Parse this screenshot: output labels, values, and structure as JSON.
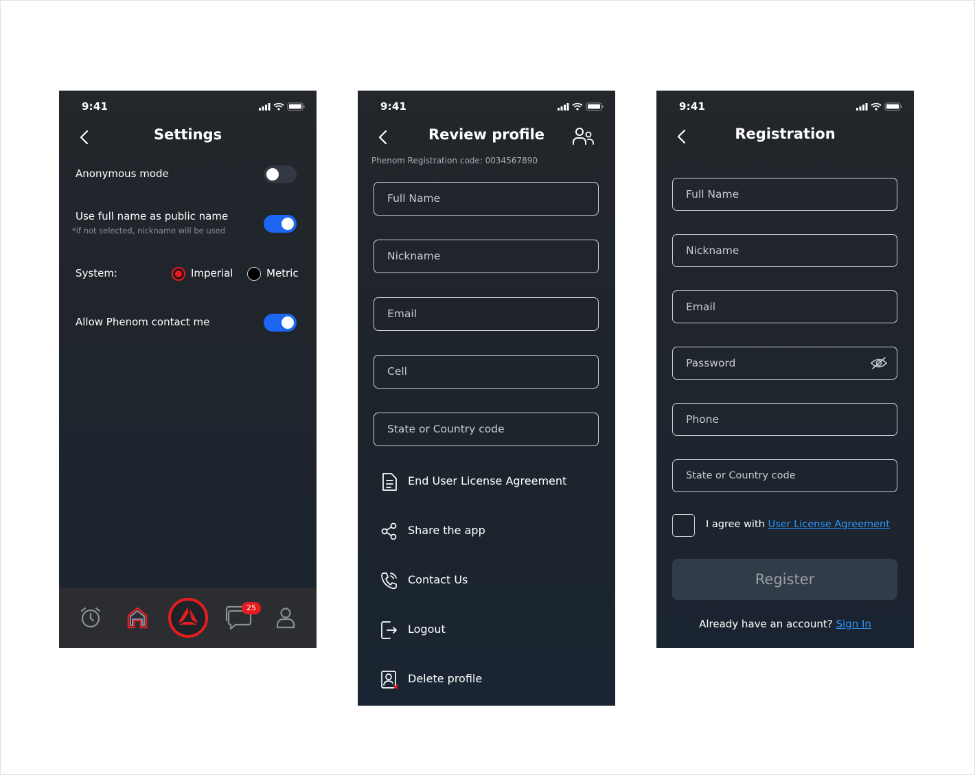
{
  "settings": {
    "status_time": "9:41",
    "title": "Settings",
    "anonymous_mode": {
      "label": "Anonymous mode",
      "enabled": false
    },
    "full_name_public": {
      "label": "Use full name as public name",
      "hint": "*if not selected, nickname will be used",
      "enabled": true
    },
    "system": {
      "label": "System:",
      "options": [
        "Imperial",
        "Metric"
      ],
      "selected": "Imperial"
    },
    "allow_contact": {
      "label": "Allow Phenom contact me",
      "enabled": true
    },
    "tabbar": {
      "items": [
        "alarm-icon",
        "home-icon",
        "phenom-logo-icon",
        "messages-icon",
        "profile-icon"
      ],
      "messages_badge": "25"
    }
  },
  "review_profile": {
    "status_time": "9:41",
    "title": "Review profile",
    "registration_code": "Phenom Registration code: 0034567890",
    "fields": [
      "Full Name",
      "Nickname",
      "Email",
      "Cell",
      "State or Country code"
    ],
    "menu": [
      {
        "label": "End User License Agreement",
        "icon": "document-icon"
      },
      {
        "label": "Share the app",
        "icon": "share-icon"
      },
      {
        "label": "Contact Us",
        "icon": "phone-call-icon"
      },
      {
        "label": "Logout",
        "icon": "logout-icon"
      },
      {
        "label": "Delete profile",
        "icon": "delete-profile-icon"
      }
    ]
  },
  "registration": {
    "status_time": "9:41",
    "title": "Registration",
    "fields": [
      "Full Name",
      "Nickname",
      "Email",
      "Password",
      "Phone",
      "State or Country code"
    ],
    "agree_prefix": "I agree with",
    "agree_link": "User License Agreement",
    "register_label": "Register",
    "have_account": "Already have an account?",
    "sign_in": "Sign In"
  },
  "colors": {
    "accent_red": "#e51d1f",
    "toggle_blue": "#1c66f2",
    "link_blue": "#2b97ff",
    "background_dark": "#20252c"
  }
}
